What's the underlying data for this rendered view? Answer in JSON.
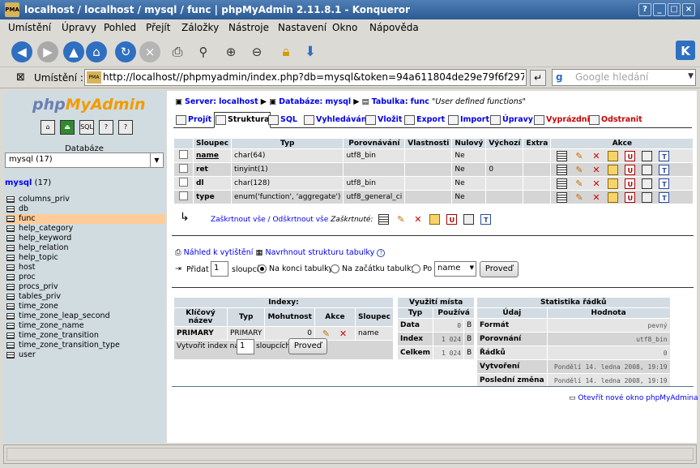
{
  "window": {
    "title": "localhost / localhost / mysql / func | phpMyAdmin 2.11.8.1 - Konqueror",
    "icon_text": "PMA"
  },
  "menubar": [
    "Umístění",
    "Úpravy",
    "Pohled",
    "Přejít",
    "Záložky",
    "Nástroje",
    "Nastavení",
    "Okno",
    "Nápověda"
  ],
  "location": {
    "label": "Umístění :",
    "url": "http://localhost//phpmyadmin/index.php?db=mysql&token=94a611804de29e79f6f2972de8ea",
    "search_placeholder": "Google hledání"
  },
  "sidebar": {
    "logo_php": "php",
    "logo_myadmin": "MyAdmin",
    "db_label": "Databáze",
    "db_selected": "mysql (17)",
    "db_name": "mysql",
    "db_count": "(17)",
    "tables": [
      "columns_priv",
      "db",
      "func",
      "help_category",
      "help_keyword",
      "help_relation",
      "help_topic",
      "host",
      "proc",
      "procs_priv",
      "tables_priv",
      "time_zone",
      "time_zone_leap_second",
      "time_zone_name",
      "time_zone_transition",
      "time_zone_transition_type",
      "user"
    ],
    "selected_table": "func"
  },
  "breadcrumb": {
    "server_label": "Server:",
    "server": "localhost",
    "db_label": "Databáze:",
    "db": "mysql",
    "table_label": "Tabulka:",
    "table": "func",
    "comment": "\"User defined functions\""
  },
  "tabs": [
    "Projít",
    "Struktura",
    "SQL",
    "Vyhledávání",
    "Vložit",
    "Export",
    "Import",
    "Úpravy",
    "Vyprázdnit",
    "Odstranit"
  ],
  "structure": {
    "headers": [
      "Sloupec",
      "Typ",
      "Porovnávání",
      "Vlastnosti",
      "Nulový",
      "Výchozí",
      "Extra",
      "Akce"
    ],
    "rows": [
      {
        "name": "name",
        "type": "char(64)",
        "collation": "utf8_bin",
        "attributes": "",
        "null": "Ne",
        "default": "",
        "extra": ""
      },
      {
        "name": "ret",
        "type": "tinyint(1)",
        "collation": "",
        "attributes": "",
        "null": "Ne",
        "default": "0",
        "extra": ""
      },
      {
        "name": "dl",
        "type": "char(128)",
        "collation": "utf8_bin",
        "attributes": "",
        "null": "Ne",
        "default": "",
        "extra": ""
      },
      {
        "name": "type",
        "type": "enum('function', 'aggregate')",
        "collation": "utf8_general_ci",
        "attributes": "",
        "null": "Ne",
        "default": "",
        "extra": ""
      }
    ],
    "check_all": "Zaškrtnout vše",
    "uncheck_all": "Odškrtnout vše",
    "separator": "/",
    "with_selected": "Zaškrtnuté:"
  },
  "print_view": "Náhled k vytištění",
  "propose_structure": "Navrhnout strukturu tabulky",
  "add_columns": {
    "label": "Přidat",
    "value": "1",
    "unit": "sloupců",
    "at_end": "Na konci tabulky",
    "at_start": "Na začátku tabulky",
    "after": "Po",
    "after_select": "name",
    "go": "Proveď"
  },
  "indexes": {
    "title": "Indexy:",
    "headers": [
      "Klíčový název",
      "Typ",
      "Mohutnost",
      "Akce",
      "Sloupec"
    ],
    "rows": [
      {
        "key": "PRIMARY",
        "type": "PRIMARY",
        "cardinality": "0",
        "column": "name"
      }
    ],
    "create_label": "Vytvořit index na",
    "create_value": "1",
    "create_unit": "sloupcích",
    "go": "Proveď"
  },
  "space_usage": {
    "title": "Využití místa",
    "headers": [
      "Typ",
      "Používá"
    ],
    "rows": [
      {
        "type": "Data",
        "value": "0",
        "unit": "B"
      },
      {
        "type": "Index",
        "value": "1 024",
        "unit": "B"
      },
      {
        "type": "Celkem",
        "value": "1 024",
        "unit": "B"
      }
    ]
  },
  "row_stats": {
    "title": "Statistika řádků",
    "headers": [
      "Údaj",
      "Hodnota"
    ],
    "rows": [
      {
        "label": "Formát",
        "value": "pevný"
      },
      {
        "label": "Porovnání",
        "value": "utf8_bin"
      },
      {
        "label": "Řádků",
        "value": "0"
      },
      {
        "label": "Vytvoření",
        "value": "Pondělí 14. ledna 2008, 19:19"
      },
      {
        "label": "Poslední změna",
        "value": "Pondělí 14. ledna 2008, 19:19"
      }
    ]
  },
  "new_window": "Otevřít nové okno phpMyAdmina",
  "colors": {
    "title_bar": "#3a6aa5",
    "sidebar_bg": "#d0dce0",
    "header_bg": "#d3dce3",
    "selected_row": "#ffcc99",
    "link": "#0000ee"
  }
}
